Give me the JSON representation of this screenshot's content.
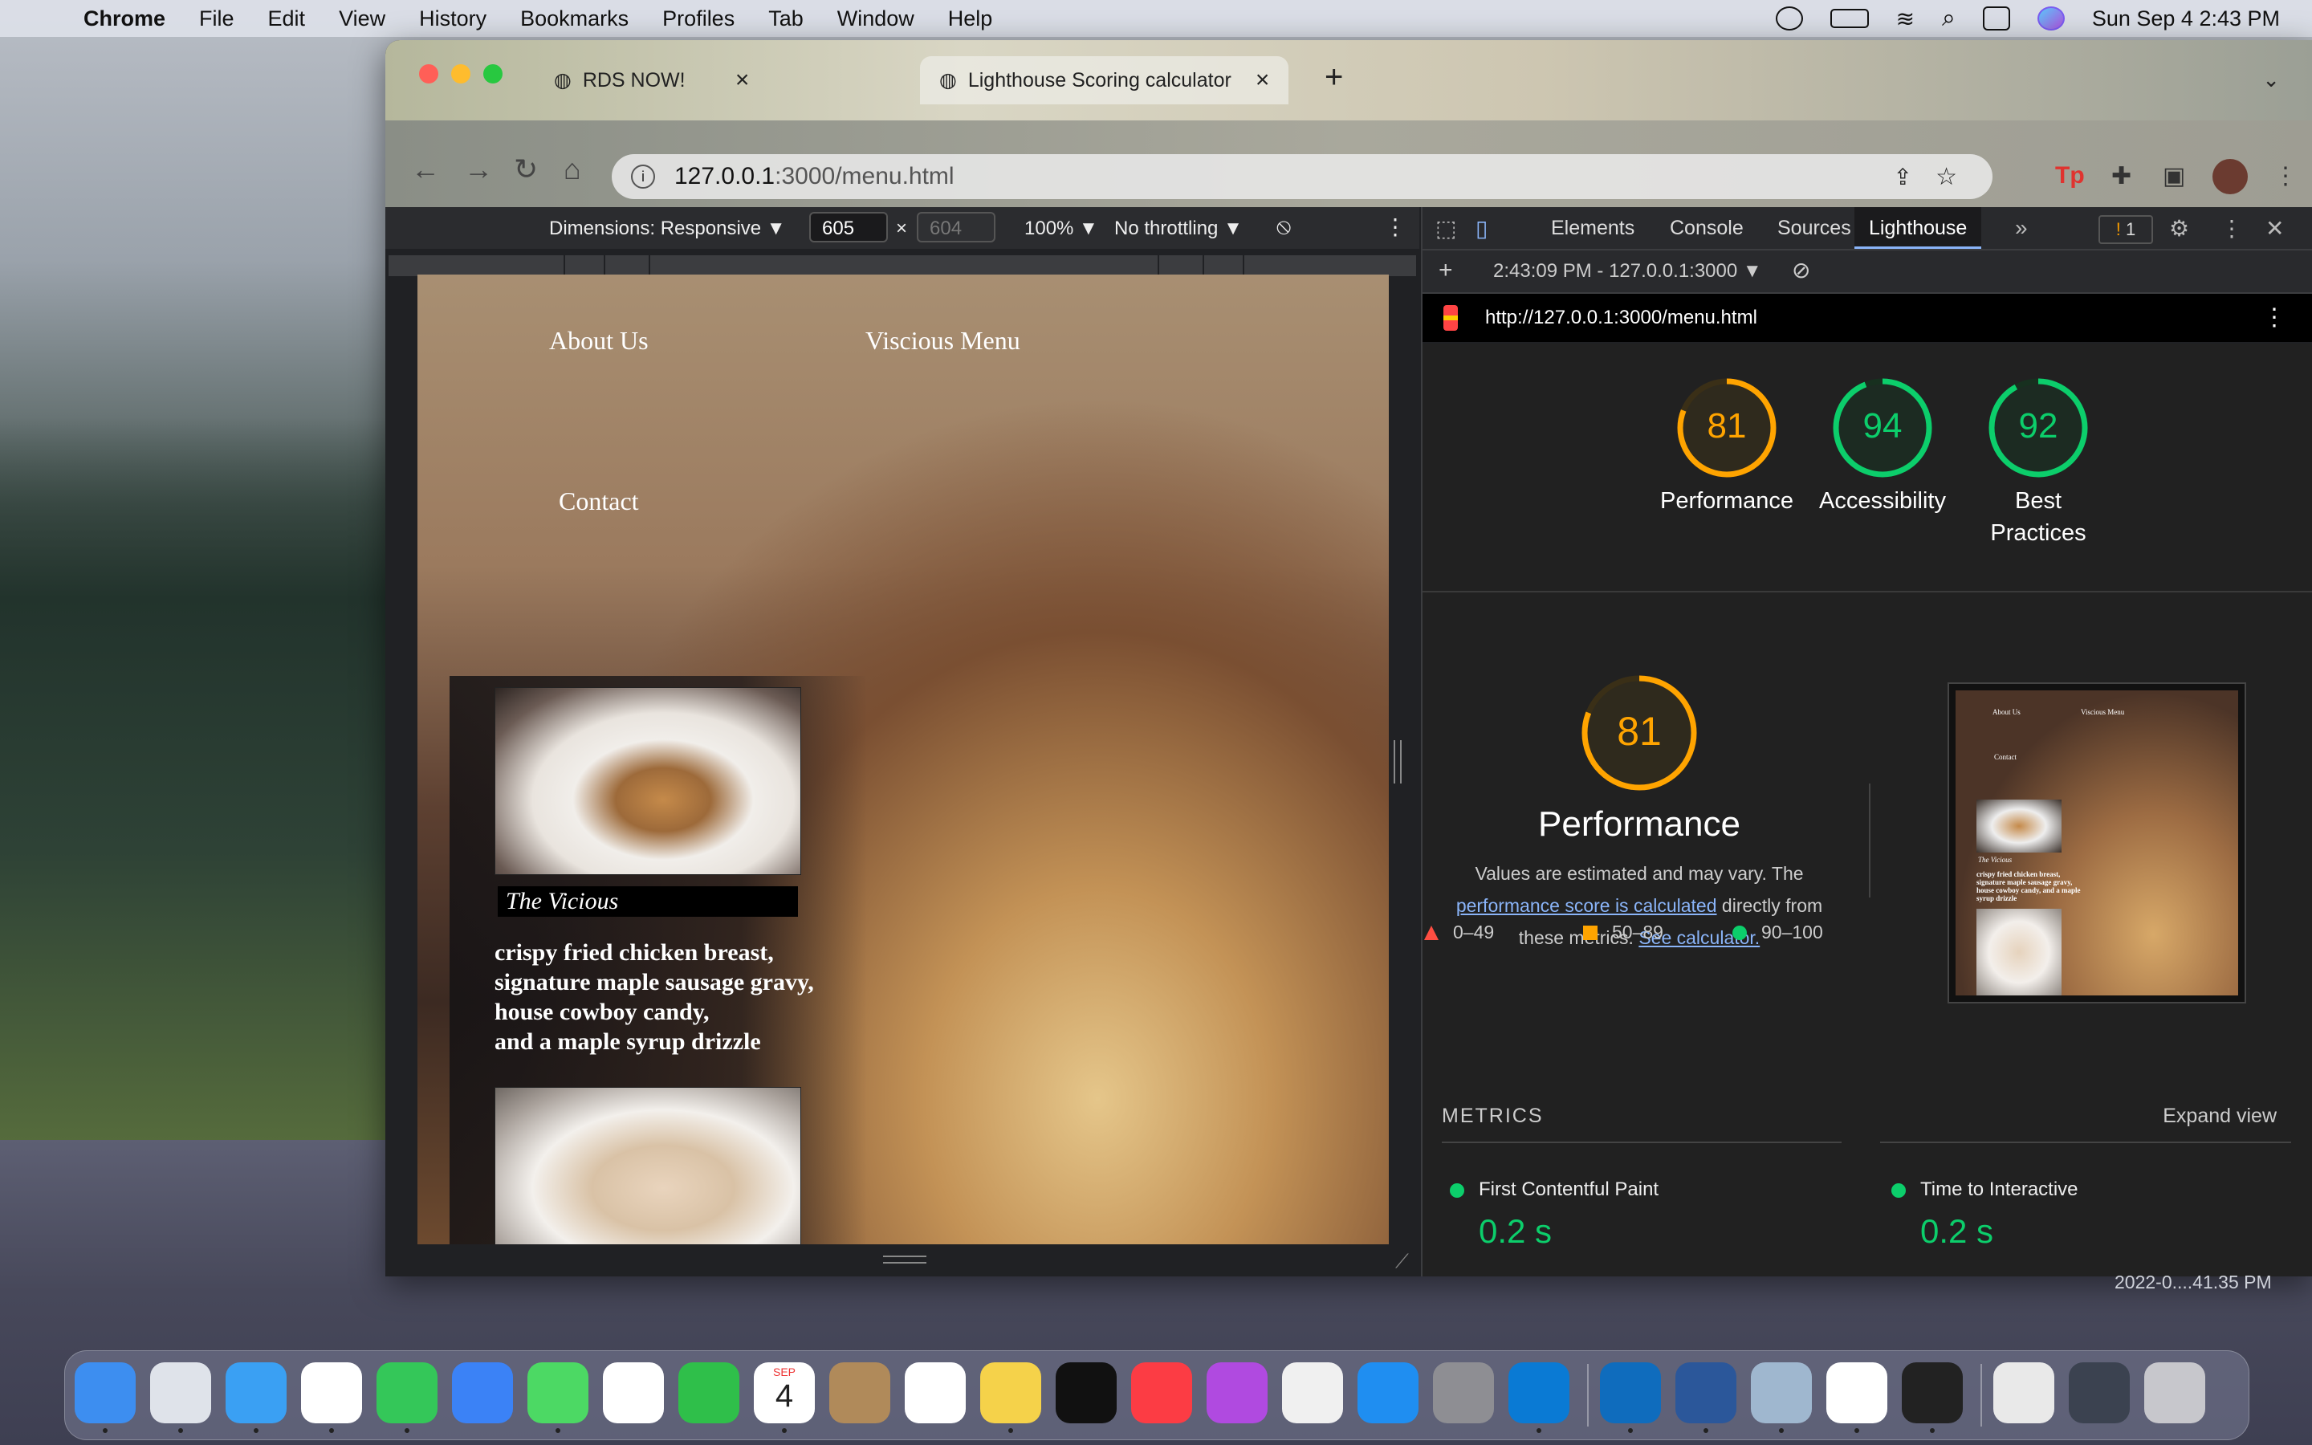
{
  "menubar": {
    "app": "Chrome",
    "items": [
      "File",
      "Edit",
      "View",
      "History",
      "Bookmarks",
      "Profiles",
      "Tab",
      "Window",
      "Help"
    ],
    "datetime": "Sun Sep 4  2:43 PM"
  },
  "browser": {
    "tabs": [
      {
        "title": "RDS NOW!",
        "active": false
      },
      {
        "title": "Lighthouse Scoring calculator",
        "active": true
      }
    ],
    "url_host": "127.0.0.1",
    "url_path": ":3000/menu.html"
  },
  "device_toolbar": {
    "dimensions": "Dimensions: Responsive ▼",
    "width": "605",
    "height": "604",
    "zoom": "100% ▼",
    "throttling": "No throttling ▼"
  },
  "site": {
    "nav": [
      "About Us",
      "Viscious Menu",
      "Contact"
    ],
    "item_title": "The Vicious",
    "item_desc": [
      "crispy fried chicken breast,",
      "signature maple sausage gravy,",
      "house cowboy candy,",
      "and a maple syrup drizzle"
    ]
  },
  "devtools": {
    "tabs": [
      "Elements",
      "Console",
      "Sources",
      "Lighthouse"
    ],
    "active_tab": "Lighthouse",
    "issues_count": "1",
    "report_time": "2:43:09 PM - 127.0.0.1:3000 ▼",
    "report_url": "http://127.0.0.1:3000/menu.html",
    "scores": [
      {
        "value": 81,
        "label": "Performance",
        "color": "#ffa400",
        "ring": "#ffa400"
      },
      {
        "value": 94,
        "label": "Accessibility",
        "color": "#0cce6b",
        "ring": "#0cce6b"
      },
      {
        "value": 92,
        "label": "Best Practices",
        "color": "#0cce6b",
        "ring": "#0cce6b"
      }
    ],
    "performance": {
      "score": 81,
      "title": "Performance",
      "text_1": "Values are estimated and may vary. The",
      "link_1": "performance score is calculated",
      "text_2": " directly from",
      "text_3": "these metrics. ",
      "link_2": "See calculator."
    },
    "legend": [
      {
        "range": "0–49",
        "shape": "triangle",
        "color": "#ff4e42"
      },
      {
        "range": "50–89",
        "shape": "square",
        "color": "#ffa400"
      },
      {
        "range": "90–100",
        "shape": "circle",
        "color": "#0cce6b"
      }
    ],
    "metrics_header": "METRICS",
    "expand_view": "Expand view",
    "metrics": [
      {
        "name": "First Contentful Paint",
        "value": "0.2 s"
      },
      {
        "name": "Time to Interactive",
        "value": "0.2 s"
      }
    ],
    "screenshot_text": {
      "nav1": "About Us",
      "nav2": "Viscious Menu",
      "nav3": "Contact",
      "title": "The Vicious",
      "desc": "crispy fried chicken breast, signature maple sausage gravy, house cowboy candy, and a maple syrup drizzle"
    }
  },
  "desktop": {
    "file_stamp": "2022-0....41.35 PM"
  },
  "dock": {
    "apps": [
      "finder-icon",
      "launchpad-icon",
      "safari-icon",
      "chrome-icon",
      "messages-icon",
      "mail-icon",
      "maps-icon",
      "photos-icon",
      "facetime-icon",
      "calendar-icon",
      "contacts-icon",
      "reminders-icon",
      "notes-icon",
      "apple-tv-icon",
      "music-icon",
      "podcasts-icon",
      "news-icon",
      "app-store-icon",
      "system-preferences-icon",
      "vscode-icon",
      "outlook-icon",
      "word-icon",
      "preview-icon",
      "slack-icon",
      "terminal-icon",
      "folder-stack-icon",
      "screenshot-stack-icon",
      "trash-icon"
    ],
    "calendar_month": "SEP",
    "calendar_day": "4"
  }
}
